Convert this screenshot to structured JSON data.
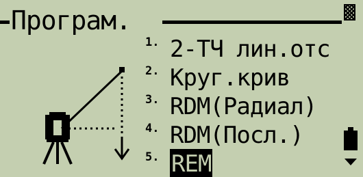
{
  "header": {
    "title": "Програм."
  },
  "menu": {
    "items": [
      {
        "num": "1.",
        "label": "2-ТЧ лин.отс",
        "selected": false
      },
      {
        "num": "2.",
        "label": "Круг.крив",
        "selected": false
      },
      {
        "num": "3.",
        "label": "RDM(Радиал)",
        "selected": false
      },
      {
        "num": "4.",
        "label": "RDM(Посл.)",
        "selected": false
      },
      {
        "num": "5.",
        "label": "REM",
        "selected": true
      }
    ]
  },
  "status": {
    "battery_icon": "battery-icon",
    "scroll_icon": "scroll-down-arrow-icon"
  },
  "colors": {
    "screen_bg": "#c4cfb0",
    "foreground": "#000000"
  }
}
